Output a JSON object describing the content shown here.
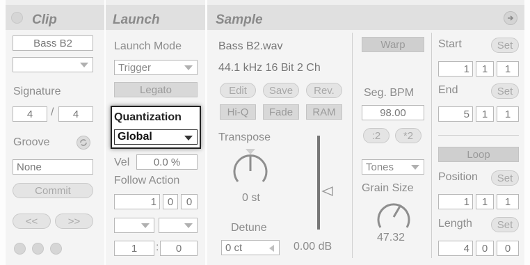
{
  "clip": {
    "title": "Clip",
    "name": "Bass B2",
    "signature_label": "Signature",
    "sig_num": "4",
    "sig_sep": "/",
    "sig_den": "4",
    "groove_label": "Groove",
    "groove_value": "None",
    "commit_label": "Commit",
    "nudge_back": "<<",
    "nudge_fwd": ">>"
  },
  "launch": {
    "title": "Launch",
    "mode_label": "Launch Mode",
    "mode_value": "Trigger",
    "legato_label": "Legato",
    "quant_label": "Quantization",
    "quant_value": "Global",
    "vel_label": "Vel",
    "vel_value": "0.0 %",
    "follow_label": "Follow Action",
    "follow_time": [
      "1",
      "0",
      "0"
    ],
    "chance_a": "1",
    "chance_sep": ":",
    "chance_b": "0"
  },
  "sample": {
    "title": "Sample",
    "file_name": "Bass B2.wav",
    "file_info": "44.1 kHz 16 Bit 2 Ch",
    "btn_edit": "Edit",
    "btn_save": "Save",
    "btn_rev": "Rev.",
    "btn_hiq": "Hi-Q",
    "btn_fade": "Fade",
    "btn_ram": "RAM",
    "transpose_label": "Transpose",
    "transpose_value": "0 st",
    "detune_label": "Detune",
    "detune_value": "0 ct",
    "gain_value": "0.00 dB",
    "warp_label": "Warp",
    "segbpm_label": "Seg. BPM",
    "segbpm_value": "98.00",
    "half_label": ":2",
    "double_label": "*2",
    "warp_mode": "Tones",
    "grain_label": "Grain Size",
    "grain_value": "47.32",
    "start_label": "Start",
    "start_value": [
      "1",
      "1",
      "1"
    ],
    "end_label": "End",
    "end_value": [
      "5",
      "1",
      "1"
    ],
    "loop_label": "Loop",
    "position_label": "Position",
    "position_value": [
      "1",
      "1",
      "1"
    ],
    "length_label": "Length",
    "length_value": [
      "4",
      "0",
      "0"
    ],
    "set_label": "Set"
  }
}
